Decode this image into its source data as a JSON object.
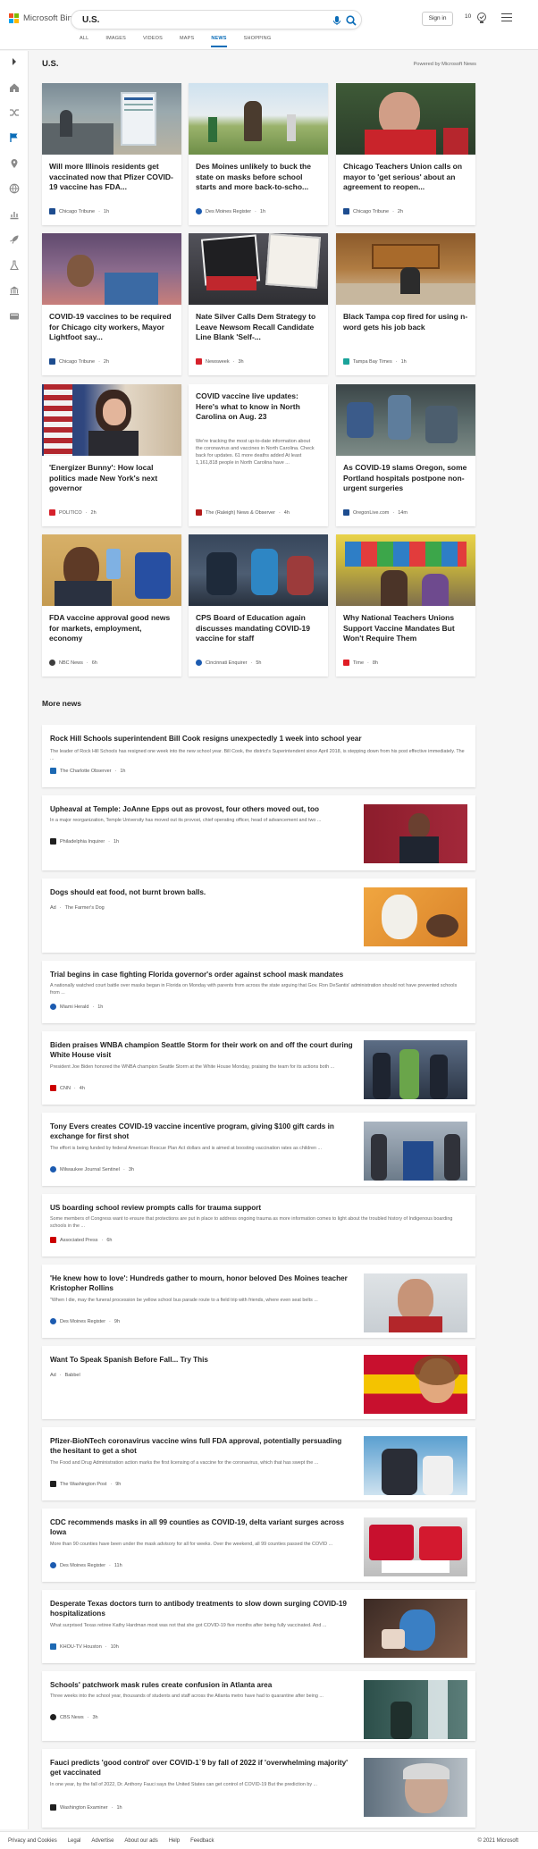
{
  "header": {
    "logo_text": "Microsoft Bing",
    "query": "U.S.",
    "signin_label": "Sign in",
    "reward_count": "10",
    "tabs": [
      {
        "label": "ALL"
      },
      {
        "label": "IMAGES"
      },
      {
        "label": "VIDEOS"
      },
      {
        "label": "MAPS"
      },
      {
        "label": "NEWS"
      },
      {
        "label": "SHOPPING"
      }
    ]
  },
  "rail_icons": [
    "expand-icon",
    "home-icon",
    "shuffle-icon",
    "flag-icon",
    "pin-icon",
    "globe-icon",
    "chart-icon",
    "rocket-icon",
    "flask-icon",
    "bank-icon",
    "video-icon"
  ],
  "section": {
    "title": "U.S.",
    "powered_by": "Powered by Microsoft News"
  },
  "cards": [
    {
      "title": "Will more Illinois residents get vaccinated now that Pfizer COVID-19 vaccine has FDA...",
      "source": "Chicago Tribune",
      "age": "1h"
    },
    {
      "title": "Des Moines unlikely to buck the state on masks before school starts and more back-to-scho...",
      "source": "Des Moines Register",
      "age": "1h"
    },
    {
      "title": "Chicago Teachers Union calls on mayor to 'get serious' about an agreement to reopen...",
      "source": "Chicago Tribune",
      "age": "2h"
    },
    {
      "title": "COVID-19 vaccines to be required for Chicago city workers, Mayor Lightfoot say...",
      "source": "Chicago Tribune",
      "age": "2h"
    },
    {
      "title": "Nate Silver Calls Dem Strategy to Leave Newsom Recall Candidate Line Blank 'Self-...",
      "source": "Newsweek",
      "age": "3h"
    },
    {
      "title": "Black Tampa cop fired for using n-word gets his job back",
      "source": "Tampa Bay Times",
      "age": "1h"
    },
    {
      "title": "'Energizer Bunny': How local politics made New York's next governor",
      "source": "POLITICO",
      "age": "2h"
    },
    {
      "title": "COVID vaccine live updates: Here's what to know in North Carolina on Aug. 23",
      "desc": "We're tracking the most up-to-date information about the coronavirus and vaccines in North Carolina. Check back for updates. 61 more deaths added At least 1,161,818 people in North Carolina have ...",
      "source": "The (Raleigh) News & Observer",
      "age": "4h"
    },
    {
      "title": "As COVID-19 slams Oregon, some Portland hospitals postpone non-urgent surgeries",
      "source": "OregonLive.com",
      "age": "14m"
    },
    {
      "title": "FDA vaccine approval good news for markets, employment, economy",
      "source": "NBC News",
      "age": "6h"
    },
    {
      "title": "CPS Board of Education again discusses mandating COVID-19 vaccine for staff",
      "source": "Cincinnati Enquirer",
      "age": "5h"
    },
    {
      "title": "Why National Teachers Unions Support Vaccine Mandates But Won't Require Them",
      "source": "Time",
      "age": "8h"
    }
  ],
  "more_news_title": "More news",
  "rows": [
    {
      "title": "Rock Hill Schools superintendent Bill Cook resigns unexpectedly 1 week into school year",
      "desc": "The leader of Rock Hill Schools has resigned one week into the new school year. Bill Cook, the district's Superintendent since April 2018, is stepping down from his post effective immediately. The ...",
      "source": "The Charlotte Observer",
      "age": "1h"
    },
    {
      "title": "Upheaval at Temple: JoAnne Epps out as provost, four others moved out, too",
      "desc": "In a major reorganization, Temple University has moved out its provost, chief operating officer, head of advancement and two ...",
      "source": "Philadelphia Inquirer",
      "age": "1h"
    },
    {
      "title": "Dogs should eat food, not burnt brown balls.",
      "ad": "Ad",
      "source": "The Farmer's Dog"
    },
    {
      "title": "Trial begins in case fighting Florida governor's order against school mask mandates",
      "desc": "A nationally watched court battle over masks began in Florida on Monday with parents from across the state arguing that Gov. Ron DeSantis' administration should not have prevented schools from ...",
      "source": "Miami Herald",
      "age": "1h"
    },
    {
      "title": "Biden praises WNBA champion Seattle Storm for their work on and off the court during White House visit",
      "desc": "President Joe Biden honored the WNBA champion Seattle Storm at the White House Monday, praising the team for its actions both ...",
      "source": "CNN",
      "age": "4h"
    },
    {
      "title": "Tony Evers creates COVID-19 vaccine incentive program, giving $100 gift cards in exchange for first shot",
      "desc": "The effort is being funded by federal American Rescue Plan Act dollars and is aimed at boosting vaccination rates as children ...",
      "source": "Milwaukee Journal Sentinel",
      "age": "3h"
    },
    {
      "title": "US boarding school review prompts calls for trauma support",
      "desc": "Some members of Congress want to ensure that protections are put in place to address ongoing trauma as more information comes to light about the troubled history of Indigenous boarding schools in the ...",
      "source": "Associated Press",
      "age": "6h"
    },
    {
      "title": "'He knew how to love': Hundreds gather to mourn, honor beloved Des Moines teacher Kristopher Rollins",
      "desc": "\"When I die, may the funeral procession be yellow school bus parade route to a field trip with friends, where even seat belts ...",
      "source": "Des Moines Register",
      "age": "9h"
    },
    {
      "title": "Want To Speak Spanish Before Fall... Try This",
      "ad": "Ad",
      "source": "Babbel"
    },
    {
      "title": "Pfizer-BioNTech coronavirus vaccine wins full FDA approval, potentially persuading the hesitant to get a shot",
      "desc": "The Food and Drug Administration action marks the first licensing of a vaccine for the coronavirus, which that has swept the ...",
      "source": "The Washington Post",
      "age": "9h"
    },
    {
      "title": "CDC recommends masks in all 99 counties as COVID-19, delta variant surges across Iowa",
      "desc": "More than 90 counties have been under the mask advisory for all for weeks. Over the weekend, all 99 counties passed the COVID ...",
      "source": "Des Moines Register",
      "age": "11h"
    },
    {
      "title": "Desperate Texas doctors turn to antibody treatments to slow down surging COVID-19 hospitalizations",
      "desc": "What surprised Texas retiree Kathy Hardman most was not that she got COVID-19 five months after being fully vaccinated. And ...",
      "source": "KHOU-TV Houston",
      "age": "10h"
    },
    {
      "title": "Schools' patchwork mask rules create confusion in Atlanta area",
      "desc": "Three weeks into the school year, thousands of students and staff across the Atlanta metro have had to quarantine after being ...",
      "source": "CBS News",
      "age": "3h"
    },
    {
      "title": "Fauci predicts 'good control' over COVID-1`9 by fall of 2022 if 'overwhelming majority' get vaccinated",
      "desc": "In one year, by the fall of 2022, Dr. Anthony Fauci says the United States can get control of COVID-19 But the prediction by ...",
      "source": "Washington Examiner",
      "age": "1h"
    }
  ],
  "footer": {
    "links": [
      {
        "label": "Privacy and Cookies"
      },
      {
        "label": "Legal"
      },
      {
        "label": "Advertise"
      },
      {
        "label": "About our ads"
      },
      {
        "label": "Help"
      },
      {
        "label": "Feedback"
      }
    ],
    "copyright": "© 2021 Microsoft"
  }
}
